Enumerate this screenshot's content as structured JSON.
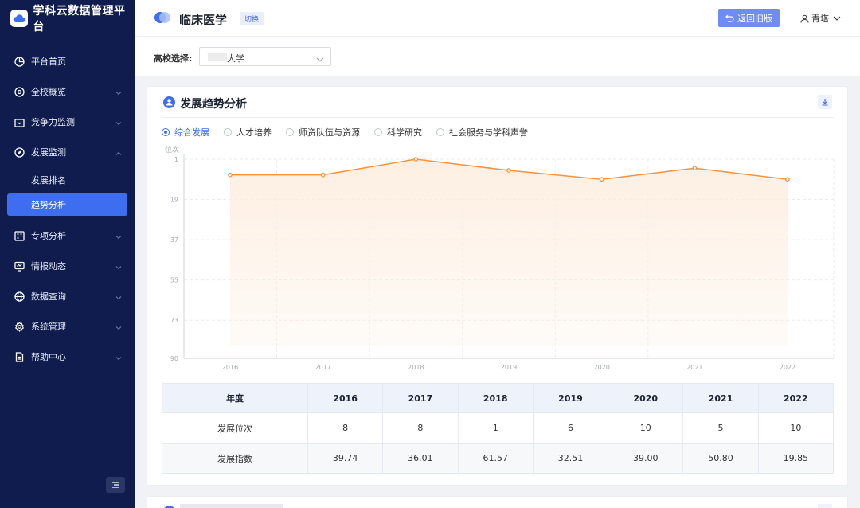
{
  "app": {
    "title": "学科云数据管理平台"
  },
  "sidebar": {
    "items": [
      {
        "label": "平台首页",
        "icon": "pie-chart-icon",
        "expandable": false
      },
      {
        "label": "全校概览",
        "icon": "target-icon",
        "expandable": true
      },
      {
        "label": "竞争力监测",
        "icon": "briefcase-icon",
        "expandable": true
      },
      {
        "label": "发展监测",
        "icon": "compass-icon",
        "expandable": true,
        "expanded": true
      },
      {
        "label": "专项分析",
        "icon": "grid-icon",
        "expandable": true
      },
      {
        "label": "情报动态",
        "icon": "monitor-icon",
        "expandable": true
      },
      {
        "label": "数据查询",
        "icon": "globe-icon",
        "expandable": true
      },
      {
        "label": "系统管理",
        "icon": "gear-icon",
        "expandable": true
      },
      {
        "label": "帮助中心",
        "icon": "document-icon",
        "expandable": true
      }
    ],
    "sub_items": [
      {
        "label": "发展排名",
        "active": false
      },
      {
        "label": "趋势分析",
        "active": true
      }
    ]
  },
  "header": {
    "title": "临床医学",
    "switch_label": "切换",
    "back_label": "返回旧版",
    "user": "青塔"
  },
  "filter": {
    "label": "高校选择:",
    "value": "大学"
  },
  "card": {
    "title": "发展趋势分析",
    "radios": [
      {
        "label": "综合发展",
        "checked": true
      },
      {
        "label": "人才培养",
        "checked": false
      },
      {
        "label": "师资队伍与资源",
        "checked": false
      },
      {
        "label": "科学研究",
        "checked": false
      },
      {
        "label": "社会服务与学科声誉",
        "checked": false
      }
    ]
  },
  "chart_data": {
    "type": "area",
    "ylabel": "位次",
    "y_inverted": true,
    "ylim": [
      1,
      90
    ],
    "y_ticks": [
      1,
      19,
      37,
      55,
      73,
      90
    ],
    "x": [
      "2016",
      "2017",
      "2018",
      "2019",
      "2020",
      "2021",
      "2022"
    ],
    "series": [
      {
        "values": [
          8,
          8,
          1,
          6,
          10,
          5,
          10
        ]
      }
    ],
    "grid": true,
    "colors": {
      "line": "#f5923e",
      "fill": "#fdeee0"
    }
  },
  "table": {
    "header_label": "年度",
    "years": [
      "2016",
      "2017",
      "2018",
      "2019",
      "2020",
      "2021",
      "2022"
    ],
    "rows": [
      {
        "label": "发展位次",
        "values": [
          "8",
          "8",
          "1",
          "6",
          "10",
          "5",
          "10"
        ]
      },
      {
        "label": "发展指数",
        "values": [
          "39.74",
          "36.01",
          "61.57",
          "32.51",
          "39.00",
          "50.80",
          "19.85"
        ]
      }
    ]
  },
  "colors": {
    "accent": "#3e6ef0",
    "sidebar_bg": "#0f1c4d"
  }
}
